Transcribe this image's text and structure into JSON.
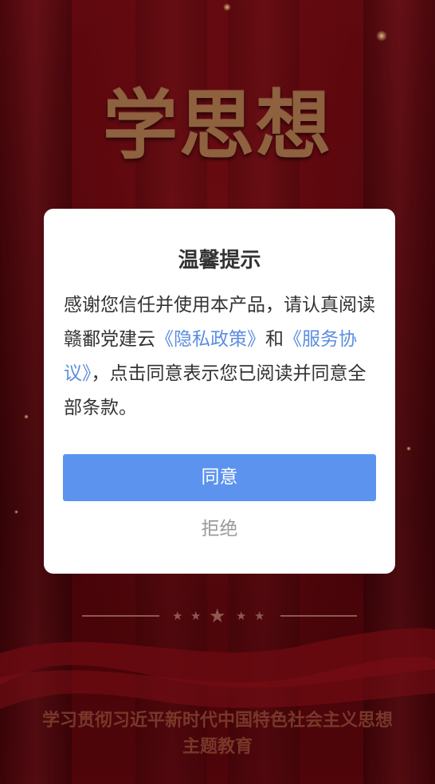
{
  "background": {
    "hero_title": "学思想",
    "footer_line1": "学习贯彻习近平新时代中国特色社会主义思想",
    "footer_line2": "主题教育"
  },
  "dialog": {
    "title": "温馨提示",
    "body_text_1": "感谢您信任并使用本产品，请认真阅读赣鄱党建云",
    "privacy_link": "《隐私政策》",
    "connector": "和",
    "service_link": "《服务协议》",
    "body_text_2": "，点击同意表示您已阅读并同意全部条款。",
    "agree_label": "同意",
    "refuse_label": "拒绝"
  },
  "colors": {
    "background": "#5a060c",
    "primary": "#5c93ef",
    "link": "#5b8de0",
    "text": "#333333",
    "muted": "#999999"
  },
  "icons": {
    "divider": "star-icon"
  }
}
